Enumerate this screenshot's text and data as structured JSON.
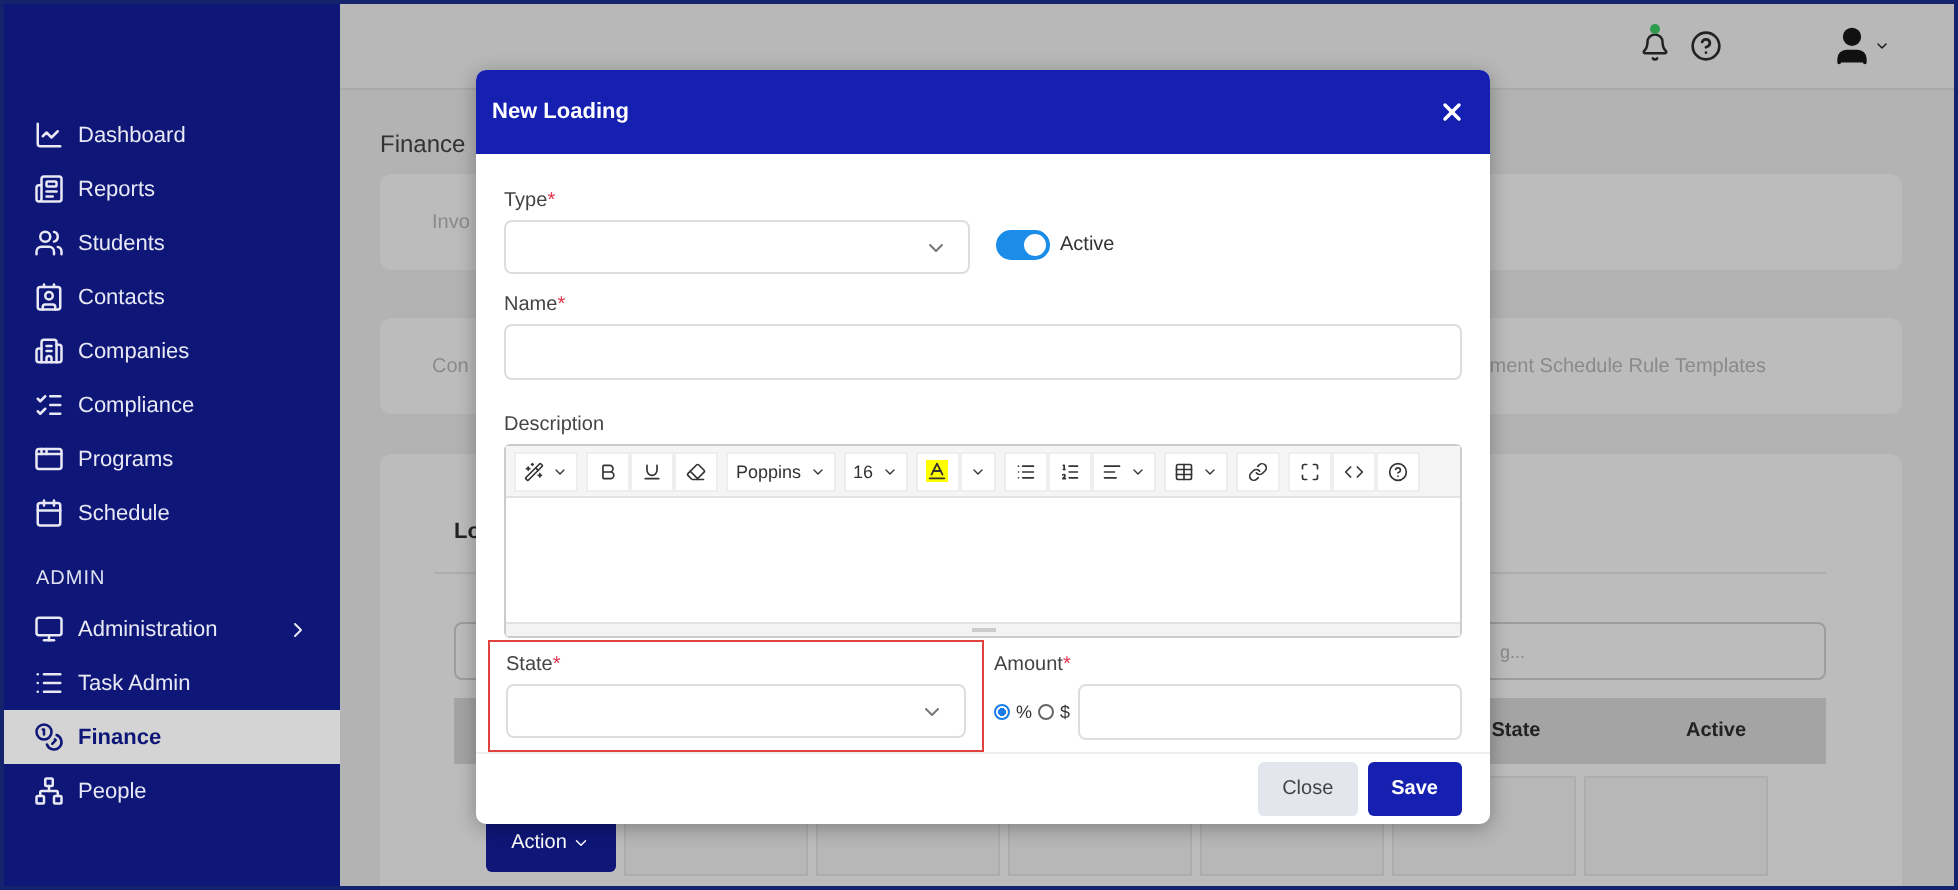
{
  "sidebar": {
    "items": [
      {
        "label": "Dashboard",
        "kind": "link",
        "selected": false
      },
      {
        "label": "Reports",
        "kind": "link",
        "selected": false
      },
      {
        "label": "Students",
        "kind": "link",
        "selected": false
      },
      {
        "label": "Contacts",
        "kind": "link",
        "selected": false
      },
      {
        "label": "Companies",
        "kind": "link",
        "selected": false
      },
      {
        "label": "Compliance",
        "kind": "link",
        "selected": false
      },
      {
        "label": "Programs",
        "kind": "link",
        "selected": false
      },
      {
        "label": "Schedule",
        "kind": "link",
        "selected": false
      }
    ],
    "admin": {
      "title": "ADMIN",
      "items": [
        {
          "label": "Administration",
          "kind": "group",
          "selected": false
        },
        {
          "label": "Task Admin",
          "kind": "link",
          "selected": false
        },
        {
          "label": "Finance",
          "kind": "link",
          "selected": true
        },
        {
          "label": "People",
          "kind": "link",
          "selected": false
        }
      ]
    }
  },
  "header": {
    "has_notification": true
  },
  "page": {
    "title": "Finance",
    "cards": [
      {
        "left": "Invo"
      },
      {
        "left": "Con",
        "right": "ment Schedule Rule Templates"
      }
    ],
    "section": {
      "heading": "Lo",
      "search_placeholder": "g...",
      "columns": [
        "State",
        "Active"
      ],
      "action": "Action"
    }
  },
  "modal": {
    "title": "New Loading",
    "type": {
      "label": "Type",
      "required_mark": "*"
    },
    "active": {
      "label": "Active",
      "on": true
    },
    "name": {
      "label": "Name",
      "required_mark": "*"
    },
    "description": {
      "label": "Description",
      "font": "Poppins",
      "size": "16"
    },
    "state": {
      "label": "State",
      "required_mark": "*",
      "invalid": true
    },
    "amount": {
      "label": "Amount",
      "required_mark": "*",
      "units": [
        {
          "label": "%",
          "selected": true
        },
        {
          "label": "$",
          "selected": false
        }
      ]
    },
    "buttons": {
      "close": "Close",
      "save": "Save"
    }
  }
}
